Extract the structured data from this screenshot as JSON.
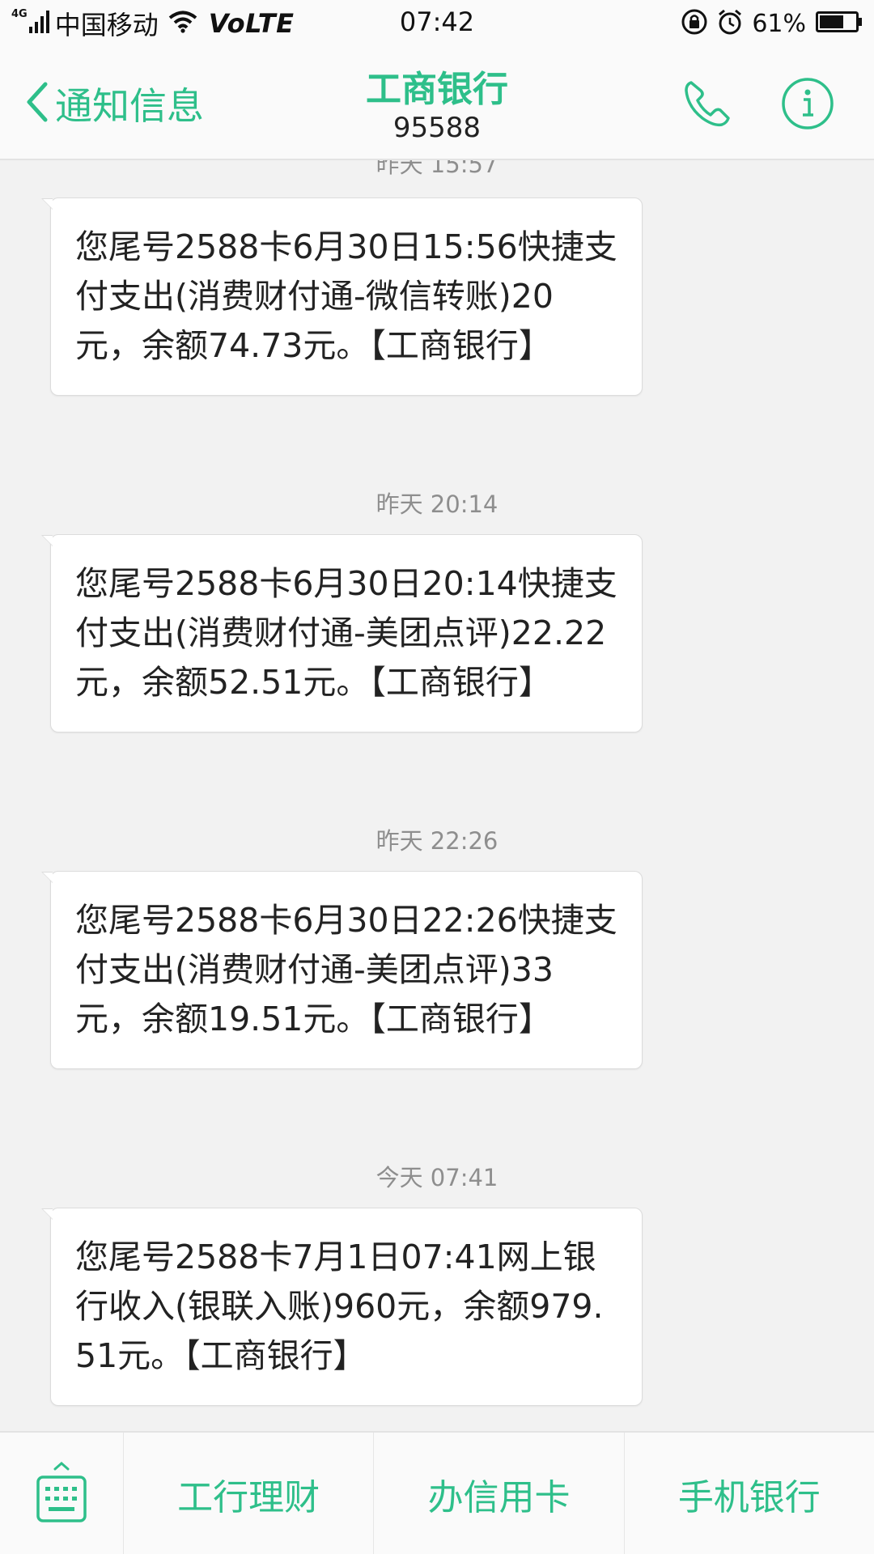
{
  "status_bar": {
    "network_type": "4G",
    "carrier": "中国移动",
    "volte": "VoLTE",
    "time": "07:42",
    "battery": "61%"
  },
  "header": {
    "back_label": "通知信息",
    "contact_name": "工商银行",
    "contact_number": "95588"
  },
  "messages": [
    {
      "timestamp": "昨天 15:57",
      "text": "您尾号2588卡6月30日15:56快捷支付支出(消费财付通-微信转账)20元，余额74.73元。【工商银行】"
    },
    {
      "timestamp": "昨天 20:14",
      "text": "您尾号2588卡6月30日20:14快捷支付支出(消费财付通-美团点评)22.22元，余额52.51元。【工商银行】"
    },
    {
      "timestamp": "昨天 22:26",
      "text": "您尾号2588卡6月30日22:26快捷支付支出(消费财付通-美团点评)33元，余额19.51元。【工商银行】"
    },
    {
      "timestamp": "今天 07:41",
      "text": "您尾号2588卡7月1日07:41网上银行收入(银联入账)960元，余额979.51元。【工商银行】"
    }
  ],
  "bottom_menu": [
    "工行理财",
    "办信用卡",
    "手机银行"
  ],
  "colors": {
    "accent": "#2ebf8a",
    "background": "#f2f2f2",
    "bubble": "#ffffff",
    "timestamp": "#8e8e8e"
  },
  "icons": {
    "back": "chevron-left-icon",
    "call": "phone-icon",
    "info": "info-icon",
    "keyboard": "keyboard-icon"
  }
}
